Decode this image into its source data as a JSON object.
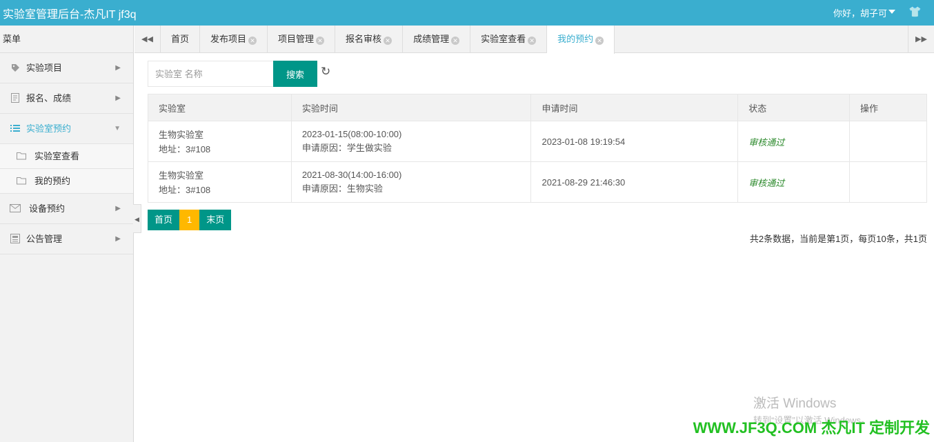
{
  "header": {
    "title": "实验室管理后台-杰凡IT jf3q",
    "user_greeting": "你好，胡子可"
  },
  "sidebar": {
    "heading": "菜单",
    "items": [
      {
        "label": "实验项目"
      },
      {
        "label": "报名、成绩"
      },
      {
        "label": "实验室预约",
        "sub": [
          {
            "label": "实验室查看"
          },
          {
            "label": "我的预约"
          }
        ]
      },
      {
        "label": "设备预约"
      },
      {
        "label": "公告管理"
      }
    ]
  },
  "tabs": [
    {
      "label": "首页"
    },
    {
      "label": "发布项目"
    },
    {
      "label": "项目管理"
    },
    {
      "label": "报名审核"
    },
    {
      "label": "成绩管理"
    },
    {
      "label": "实验室查看"
    },
    {
      "label": "我的预约"
    }
  ],
  "search": {
    "placeholder": "实验室 名称",
    "button_label": "搜索"
  },
  "table": {
    "headers": [
      "实验室",
      "实验时间",
      "申请时间",
      "状态",
      "操作"
    ],
    "rows": [
      {
        "lab_name": "生物实验室",
        "lab_address": "地址：3#108",
        "time": "2023-01-15(08:00-10:00)",
        "reason": "申请原因：学生做实验",
        "applied_at": "2023-01-08 19:19:54",
        "status": "审核通过",
        "action": ""
      },
      {
        "lab_name": "生物实验室",
        "lab_address": "地址：3#108",
        "time": "2021-08-30(14:00-16:00)",
        "reason": "申请原因：生物实验",
        "applied_at": "2021-08-29 21:46:30",
        "status": "审核通过",
        "action": ""
      }
    ]
  },
  "pagination": {
    "first": "首页",
    "current": "1",
    "last": "末页",
    "info": "共2条数据，当前是第1页，每页10条，共1页"
  },
  "overlay": {
    "activate_title": "激活 Windows",
    "activate_sub": "转到“设置”以激活 Windows。",
    "brand": "WWW.JF3Q.COM 杰凡IT  定制开发"
  }
}
